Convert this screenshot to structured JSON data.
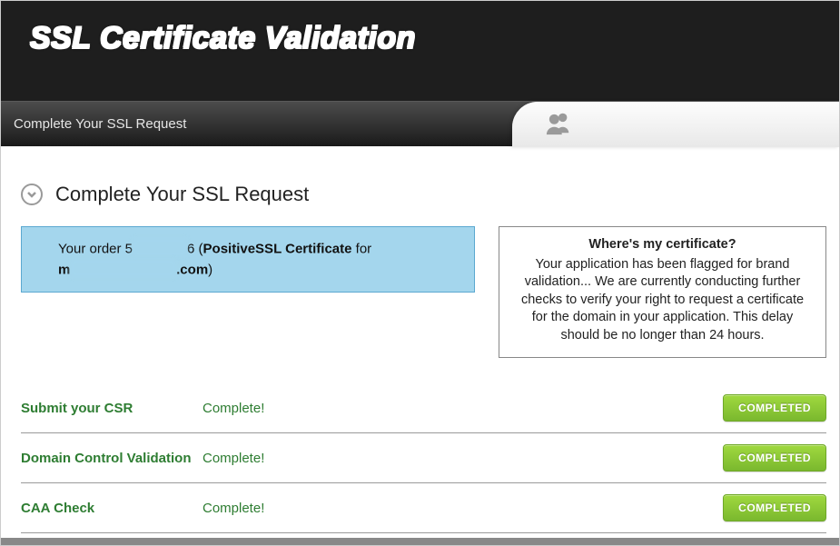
{
  "banner": {
    "title": "SSL Certificate Validation"
  },
  "toolbar": {
    "label": "Complete Your SSL Request"
  },
  "section": {
    "title": "Complete Your SSL Request",
    "order": {
      "prefix": "Your order ",
      "order_number_visible_start": "5",
      "order_number_visible_end": "6",
      "open_paren": " (",
      "product": "PositiveSSL Certificate",
      "for_word": " for ",
      "domain_visible_start": "m",
      "domain_suffix": ".com",
      "close_paren": ")"
    },
    "info": {
      "title": "Where's my certificate?",
      "body": "Your application has been flagged for brand validation... We are currently conducting further checks to verify your right to request a certificate for the domain in your application. This delay should be no longer than 24 hours."
    }
  },
  "steps": [
    {
      "name": "Submit your CSR",
      "status": "Complete!",
      "badge": "COMPLETED"
    },
    {
      "name": "Domain Control Validation",
      "status": "Complete!",
      "badge": "COMPLETED"
    },
    {
      "name": "CAA Check",
      "status": "Complete!",
      "badge": "COMPLETED"
    }
  ]
}
